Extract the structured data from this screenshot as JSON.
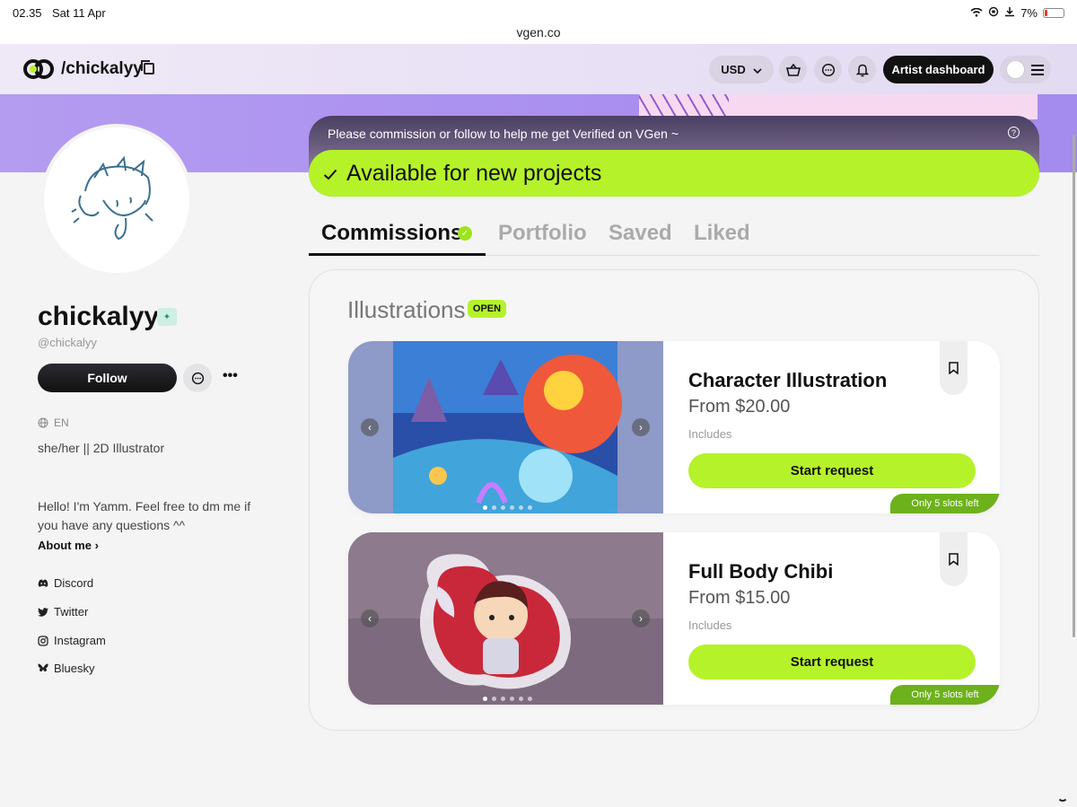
{
  "status_bar": {
    "time": "02.35",
    "date": "Sat 11 Apr",
    "battery": "7%"
  },
  "browser": {
    "url": "vgen.co"
  },
  "header": {
    "handle": "/chickalyy",
    "currency": "USD",
    "artist_dashboard_label": "Artist dashboard"
  },
  "profile": {
    "name": "chickalyy",
    "username": "@chickalyy",
    "follow_label": "Follow",
    "more_label": "•••",
    "language": "EN",
    "pronouns": "she/her || 2D Illustrator",
    "bio": "Hello! I'm Yamm. Feel free to dm me if you have any questions ^^",
    "about_label": "About me",
    "socials": [
      {
        "label": "Discord",
        "icon": "discord-icon"
      },
      {
        "label": "Twitter",
        "icon": "twitter-icon"
      },
      {
        "label": "Instagram",
        "icon": "instagram-icon"
      },
      {
        "label": "Bluesky",
        "icon": "bluesky-icon"
      }
    ]
  },
  "notice": {
    "text": "Please commission or follow to help me get Verified on VGen ~",
    "status": "Available for new projects"
  },
  "tabs": [
    {
      "label": "Commissions",
      "active": true
    },
    {
      "label": "Portfolio",
      "active": false
    },
    {
      "label": "Saved",
      "active": false
    },
    {
      "label": "Liked",
      "active": false
    }
  ],
  "section": {
    "title": "Illustrations",
    "badge": "OPEN"
  },
  "commissions": [
    {
      "title": "Character Illustration",
      "price": "From $20.00",
      "includes_label": "Includes",
      "cta": "Start request",
      "slots": "Only 5 slots left"
    },
    {
      "title": "Full Body Chibi",
      "price": "From $15.00",
      "includes_label": "Includes",
      "cta": "Start request",
      "slots": "Only 5 slots left"
    }
  ],
  "colors": {
    "accent_lime": "#b5f22a",
    "banner_purple": "#a98ef0",
    "slots_green": "#6db11c"
  }
}
